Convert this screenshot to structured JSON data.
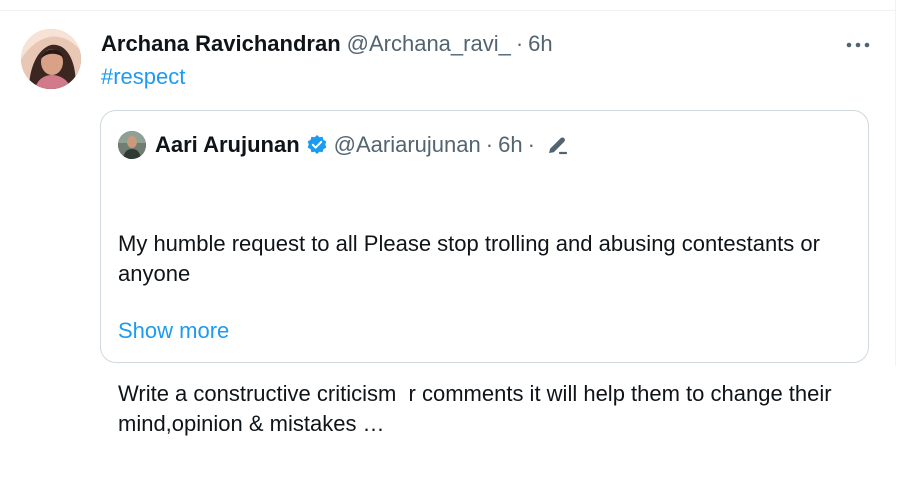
{
  "tweet": {
    "author_name": "Archana Ravichandran",
    "author_handle": "@Archana_ravi_",
    "separator": "·",
    "time": "6h",
    "hashtag": "#respect",
    "more_icon": "more-horizontal-icon"
  },
  "quoted": {
    "author_name": "Aari Arujunan",
    "author_handle": "@Aariarujunan",
    "separator": "·",
    "time": "6h",
    "separator2": "·",
    "verified_icon": "verified-badge-icon",
    "edit_icon": "edit-pencil-icon",
    "paragraph1": "My humble request to all Please stop trolling and abusing contestants or anyone",
    "paragraph2": "Write a constructive criticism  r comments it will help them to change their mind,opinion & mistakes …",
    "show_more": "Show more"
  },
  "colors": {
    "text_primary": "#0f1419",
    "text_secondary": "#536471",
    "link": "#1d9bf0",
    "border": "#cfd9de"
  }
}
